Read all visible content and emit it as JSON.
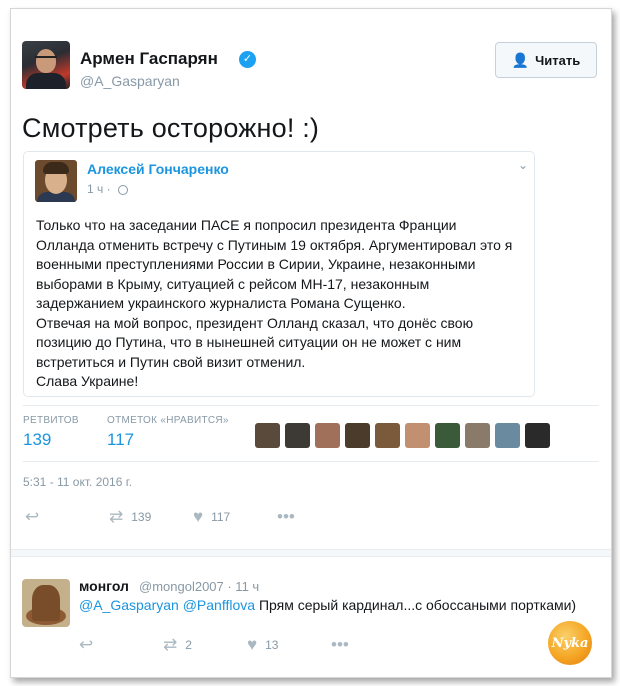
{
  "tweet": {
    "author_name": "Армен Гаспарян",
    "author_handle": "@A_Gasparyan",
    "follow_label": "Читать",
    "text": "Смотреть осторожно! :)"
  },
  "quote": {
    "author_name": "Алексей Гончаренко",
    "time": "1 ч",
    "lines": [
      "Только что на заседании ПАСЕ я попросил президента Франции",
      "Олланда отменить встречу с Путиным 19 октября. Аргументировал это я",
      "военными преступлениями России в Сирии, Украине, незаконными",
      "выборами в Крыму, ситуацией с рейсом MH-17, незаконным",
      "задержанием украинского журналиста Романа Сущенко.",
      "Отвечая на мой вопрос, президент Олланд сказал, что донёс свою",
      "позицию до Путина, что в нынешней ситуации он не может с ним",
      "встретиться и Путин свой визит отменил.",
      "Слава Украине!"
    ]
  },
  "stats": {
    "retweets_label": "РЕТВИТОВ",
    "retweets": "139",
    "likes_label": "ОТМЕТОК «НРАВИТСЯ»",
    "likes": "117",
    "liker_colors": [
      "#5a4a3c",
      "#3d3a36",
      "#a0705a",
      "#4a3b2a",
      "#7a5a3a",
      "#c09070",
      "#3a5a3a",
      "#8a7a6a",
      "#6a8aa0",
      "#2a2a2a"
    ]
  },
  "timestamp": "5:31 - 11 окт. 2016 г.",
  "actions": {
    "retweet_count": "139",
    "like_count": "117"
  },
  "reply": {
    "author_name": "монгол",
    "meta": "@mongol2007 · 11 ч",
    "mention1": "@A_Gasparyan",
    "mention2": "@Panfflova",
    "text": " Прям серый кардинал...с обоссаными портками)",
    "retweet_count": "2",
    "like_count": "13"
  },
  "watermark": "Nyka"
}
